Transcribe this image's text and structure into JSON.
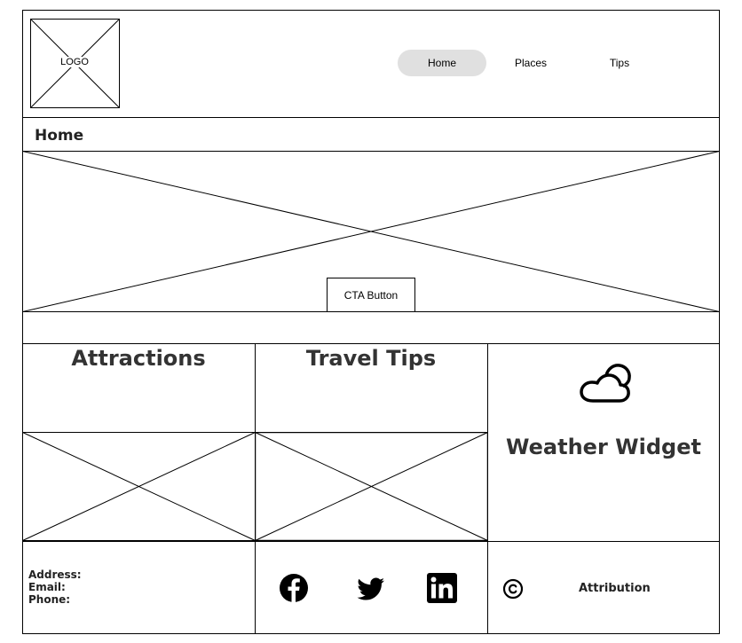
{
  "header": {
    "logo_text": "LOGO",
    "nav": [
      {
        "label": "Home",
        "active": true
      },
      {
        "label": "Places",
        "active": false
      },
      {
        "label": "Tips",
        "active": false
      }
    ]
  },
  "page_title": "Home",
  "hero": {
    "cta_label": "CTA Button"
  },
  "sections": {
    "attractions_title": "Attractions",
    "travel_tips_title": "Travel Tips",
    "weather_title": "Weather Widget",
    "weather_icon": "cloud-icon"
  },
  "footer": {
    "address_label": "Address:",
    "email_label": "Email:",
    "phone_label": "Phone:",
    "social": [
      "facebook-icon",
      "twitter-icon",
      "linkedin-icon"
    ],
    "copyright_icon": "copyright-icon",
    "attribution": "Attribution"
  },
  "colors": {
    "nav_active_bg": "#e0e0e0",
    "wire_stroke": "#000000"
  }
}
